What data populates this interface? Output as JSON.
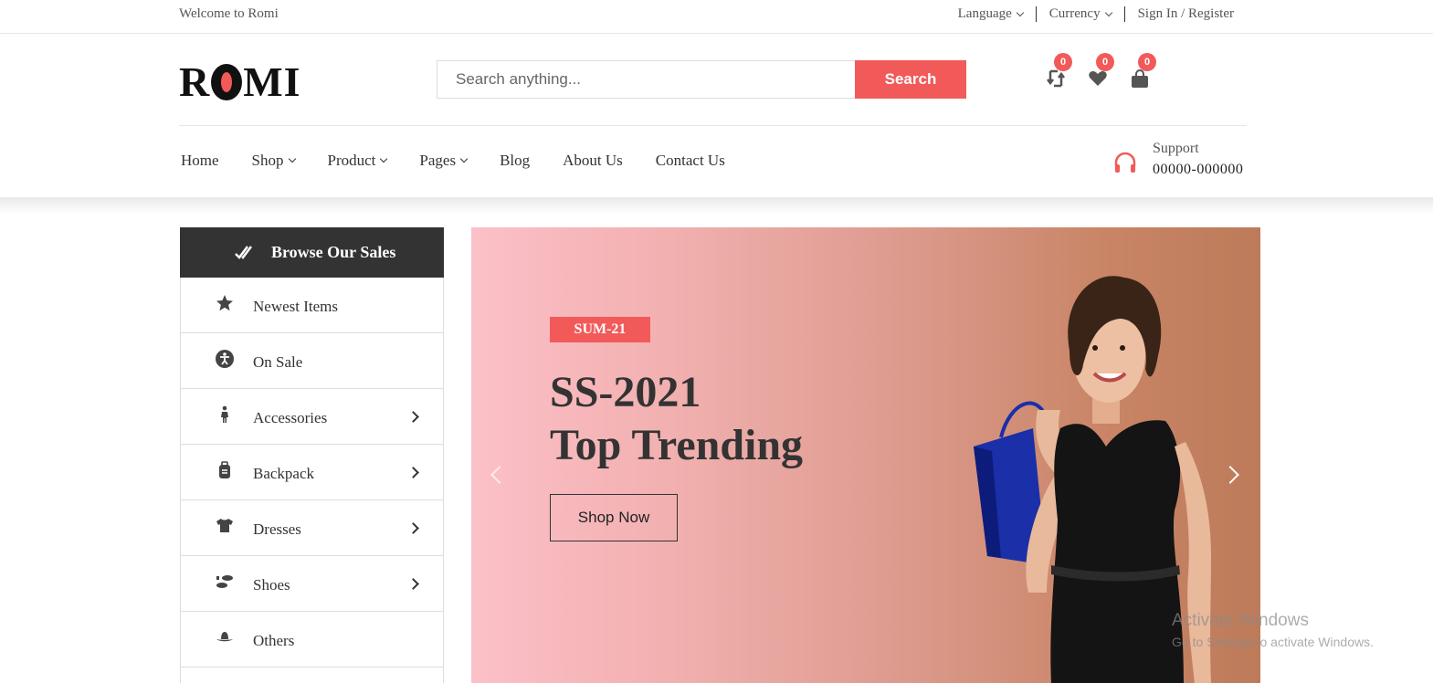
{
  "topbar": {
    "welcome": "Welcome to Romi",
    "language": "Language",
    "currency": "Currency",
    "signin": "Sign In / Register"
  },
  "header": {
    "logo_prefix": "R",
    "logo_suffix": "MI",
    "search_placeholder": "Search anything...",
    "search_button": "Search",
    "compare_count": "0",
    "wishlist_count": "0",
    "cart_count": "0"
  },
  "nav": {
    "items": [
      "Home",
      "Shop",
      "Product",
      "Pages",
      "Blog",
      "About Us",
      "Contact Us"
    ],
    "support_label": "Support",
    "support_phone": "00000-000000"
  },
  "sidebar": {
    "title": "Browse Our Sales",
    "items": [
      {
        "label": "Newest Items",
        "icon": "star-icon"
      },
      {
        "label": "On Sale",
        "icon": "accessibility-icon"
      },
      {
        "label": "Accessories",
        "icon": "child-icon"
      },
      {
        "label": "Backpack",
        "icon": "suitcase-icon"
      },
      {
        "label": "Dresses",
        "icon": "tshirt-icon"
      },
      {
        "label": "Shoes",
        "icon": "shoe-prints-icon"
      },
      {
        "label": "Others",
        "icon": "hat-icon"
      }
    ]
  },
  "banner": {
    "tag": "SUM-21",
    "line1": "SS-2021",
    "line2": "Top Trending",
    "cta": "Shop Now"
  },
  "watermark": {
    "line1": "Activate Windows",
    "line2": "Go to Settings to activate Windows."
  },
  "colors": {
    "accent": "#f25a5a",
    "dark": "#333333"
  }
}
